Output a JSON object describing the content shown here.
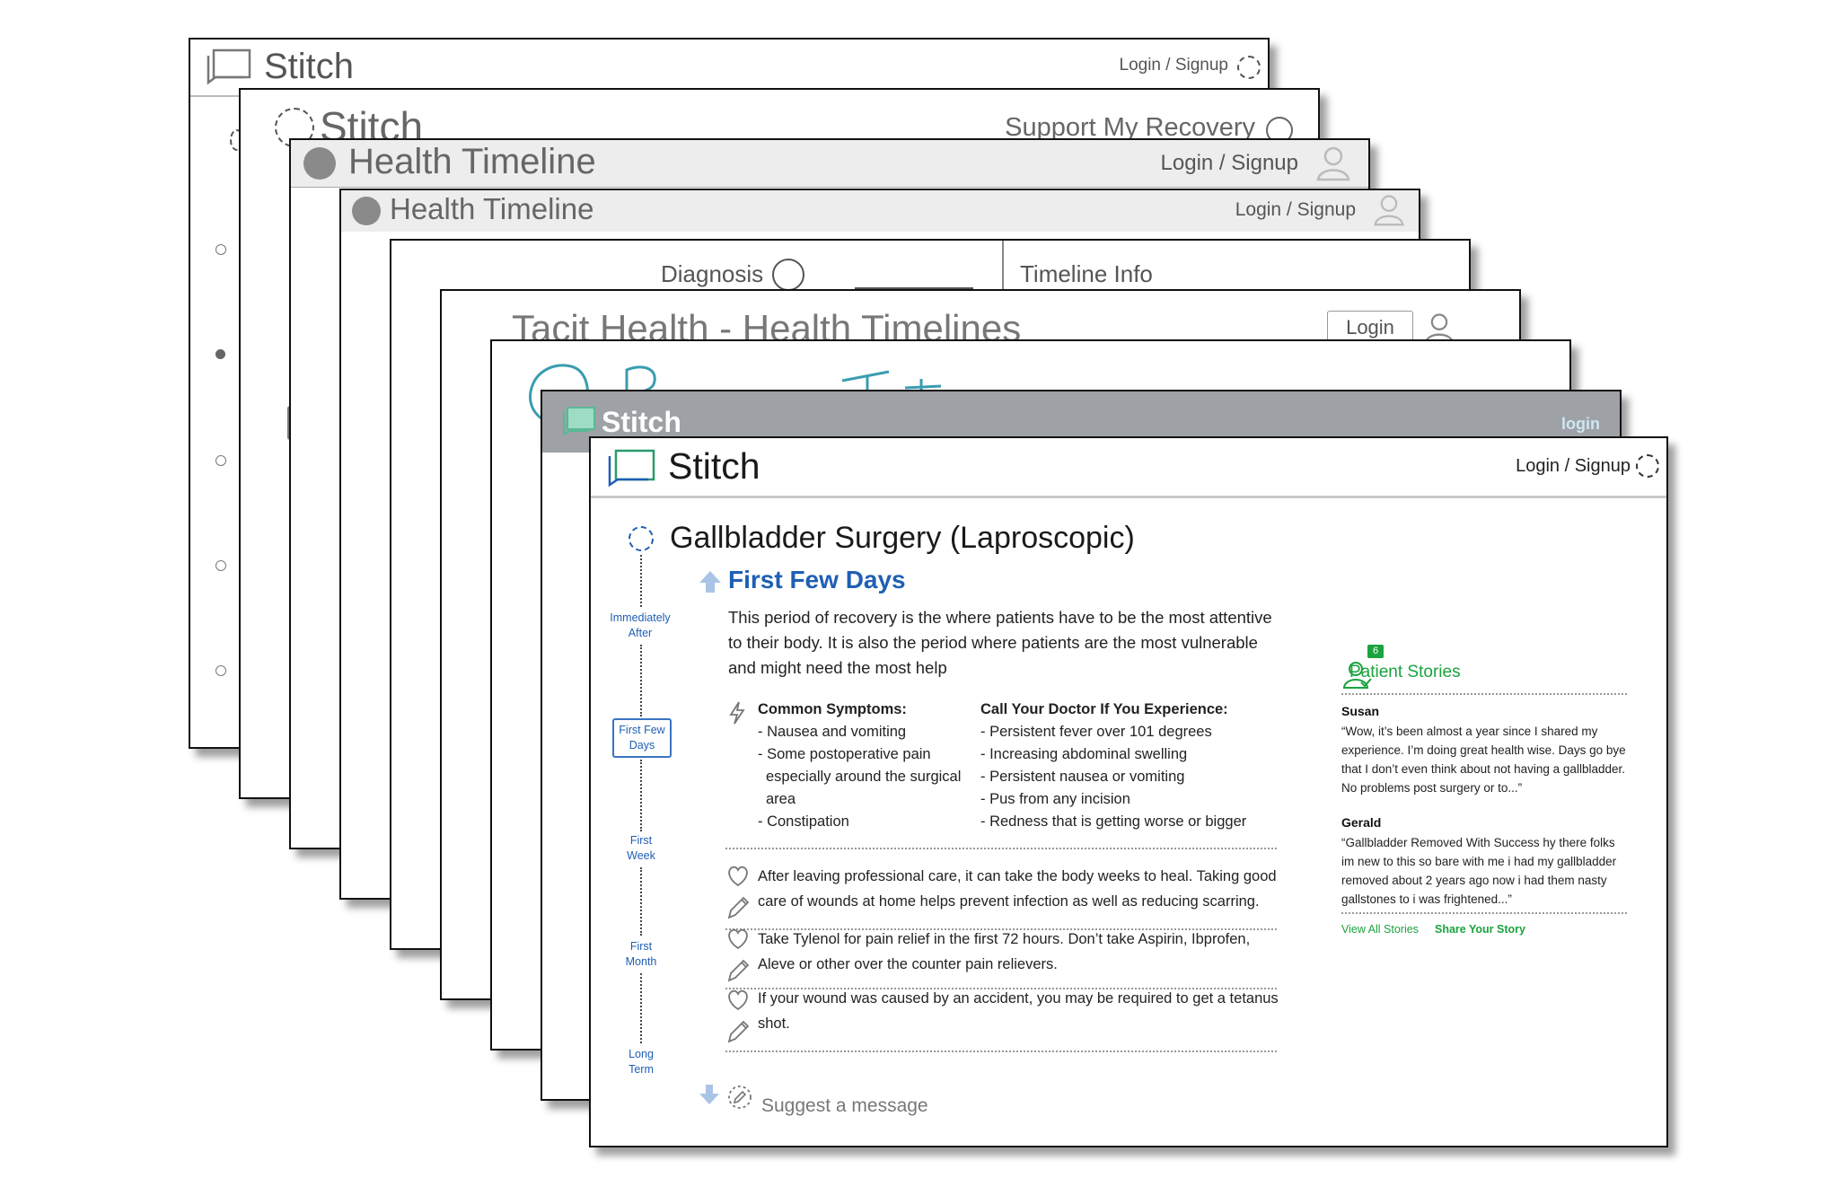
{
  "sheet1": {
    "brand": "Stitch",
    "login": "Login / Signup"
  },
  "sheet2": {
    "brand": "Stitch",
    "support": "Support My Recovery"
  },
  "sheet3": {
    "title": "Health Timeline",
    "login": "Login / Signup"
  },
  "sheet4": {
    "title": "Health Timeline",
    "login": "Login / Signup"
  },
  "sheet5": {
    "diagnosis": "Diagnosis",
    "timeline_info": "Timeline Info"
  },
  "sheet6": {
    "title": "Tacit Health - Health Timelines",
    "login": "Login"
  },
  "sheet8": {
    "brand": "Stitch",
    "login": "login"
  },
  "front": {
    "brand": "Stitch",
    "login": "Login / Signup",
    "title": "Gallbladder Surgery (Laproscopic)",
    "section": "First Few Days",
    "intro": "This period of recovery is the where patients have to be the most attentive to their body.  It is also the period where patients are the most vulnerable and might need the most help",
    "symptoms": {
      "heading": "Common Symptoms:",
      "items": [
        "- Nausea and vomiting",
        "- Some postoperative pain especially around the surgical area",
        "- Constipation"
      ]
    },
    "call_doctor": {
      "heading": "Call Your Doctor If You Experience:",
      "items": [
        "- Persistent fever over 101 degrees",
        "- Increasing abdominal swelling",
        "- Persistent nausea or vomiting",
        "- Pus from any incision",
        "- Redness that is getting worse or bigger"
      ]
    },
    "tips": [
      "After leaving professional care, it can take the body weeks to heal. Taking good care of wounds at home helps prevent infection as well as reducing scarring.",
      "Take Tylenol for pain relief in the first 72 hours. Don’t take Aspirin, Ibprofen, Aleve or other over the counter pain relievers.",
      "If your wound was caused by an accident, you may be required to get a tetanus shot."
    ],
    "suggest": "Suggest a message",
    "timeline": [
      "Immediately After",
      "First Few Days",
      "First Week",
      "First Month",
      "Long Term"
    ],
    "stories": {
      "heading": "Patient Stories",
      "badge": "6",
      "entries": [
        {
          "name": "Susan",
          "text": "“Wow, it’s been almost a year since I shared my experience. I’m doing great health wise. Days go bye that I don’t even think about not having a gallbladder. No problems post surgery or to...”"
        },
        {
          "name": "Gerald",
          "text": "“Gallbladder Removed With Success hy there folks im new to this so bare with me i had my gallbladder removed about 2 years ago now i had them nasty gallstones to i was frightened...”"
        }
      ],
      "view_all": "View All Stories",
      "share": "Share Your Story"
    },
    "colors": {
      "accent_blue": "#1f5fb4",
      "accent_green": "#1ba33f"
    }
  }
}
